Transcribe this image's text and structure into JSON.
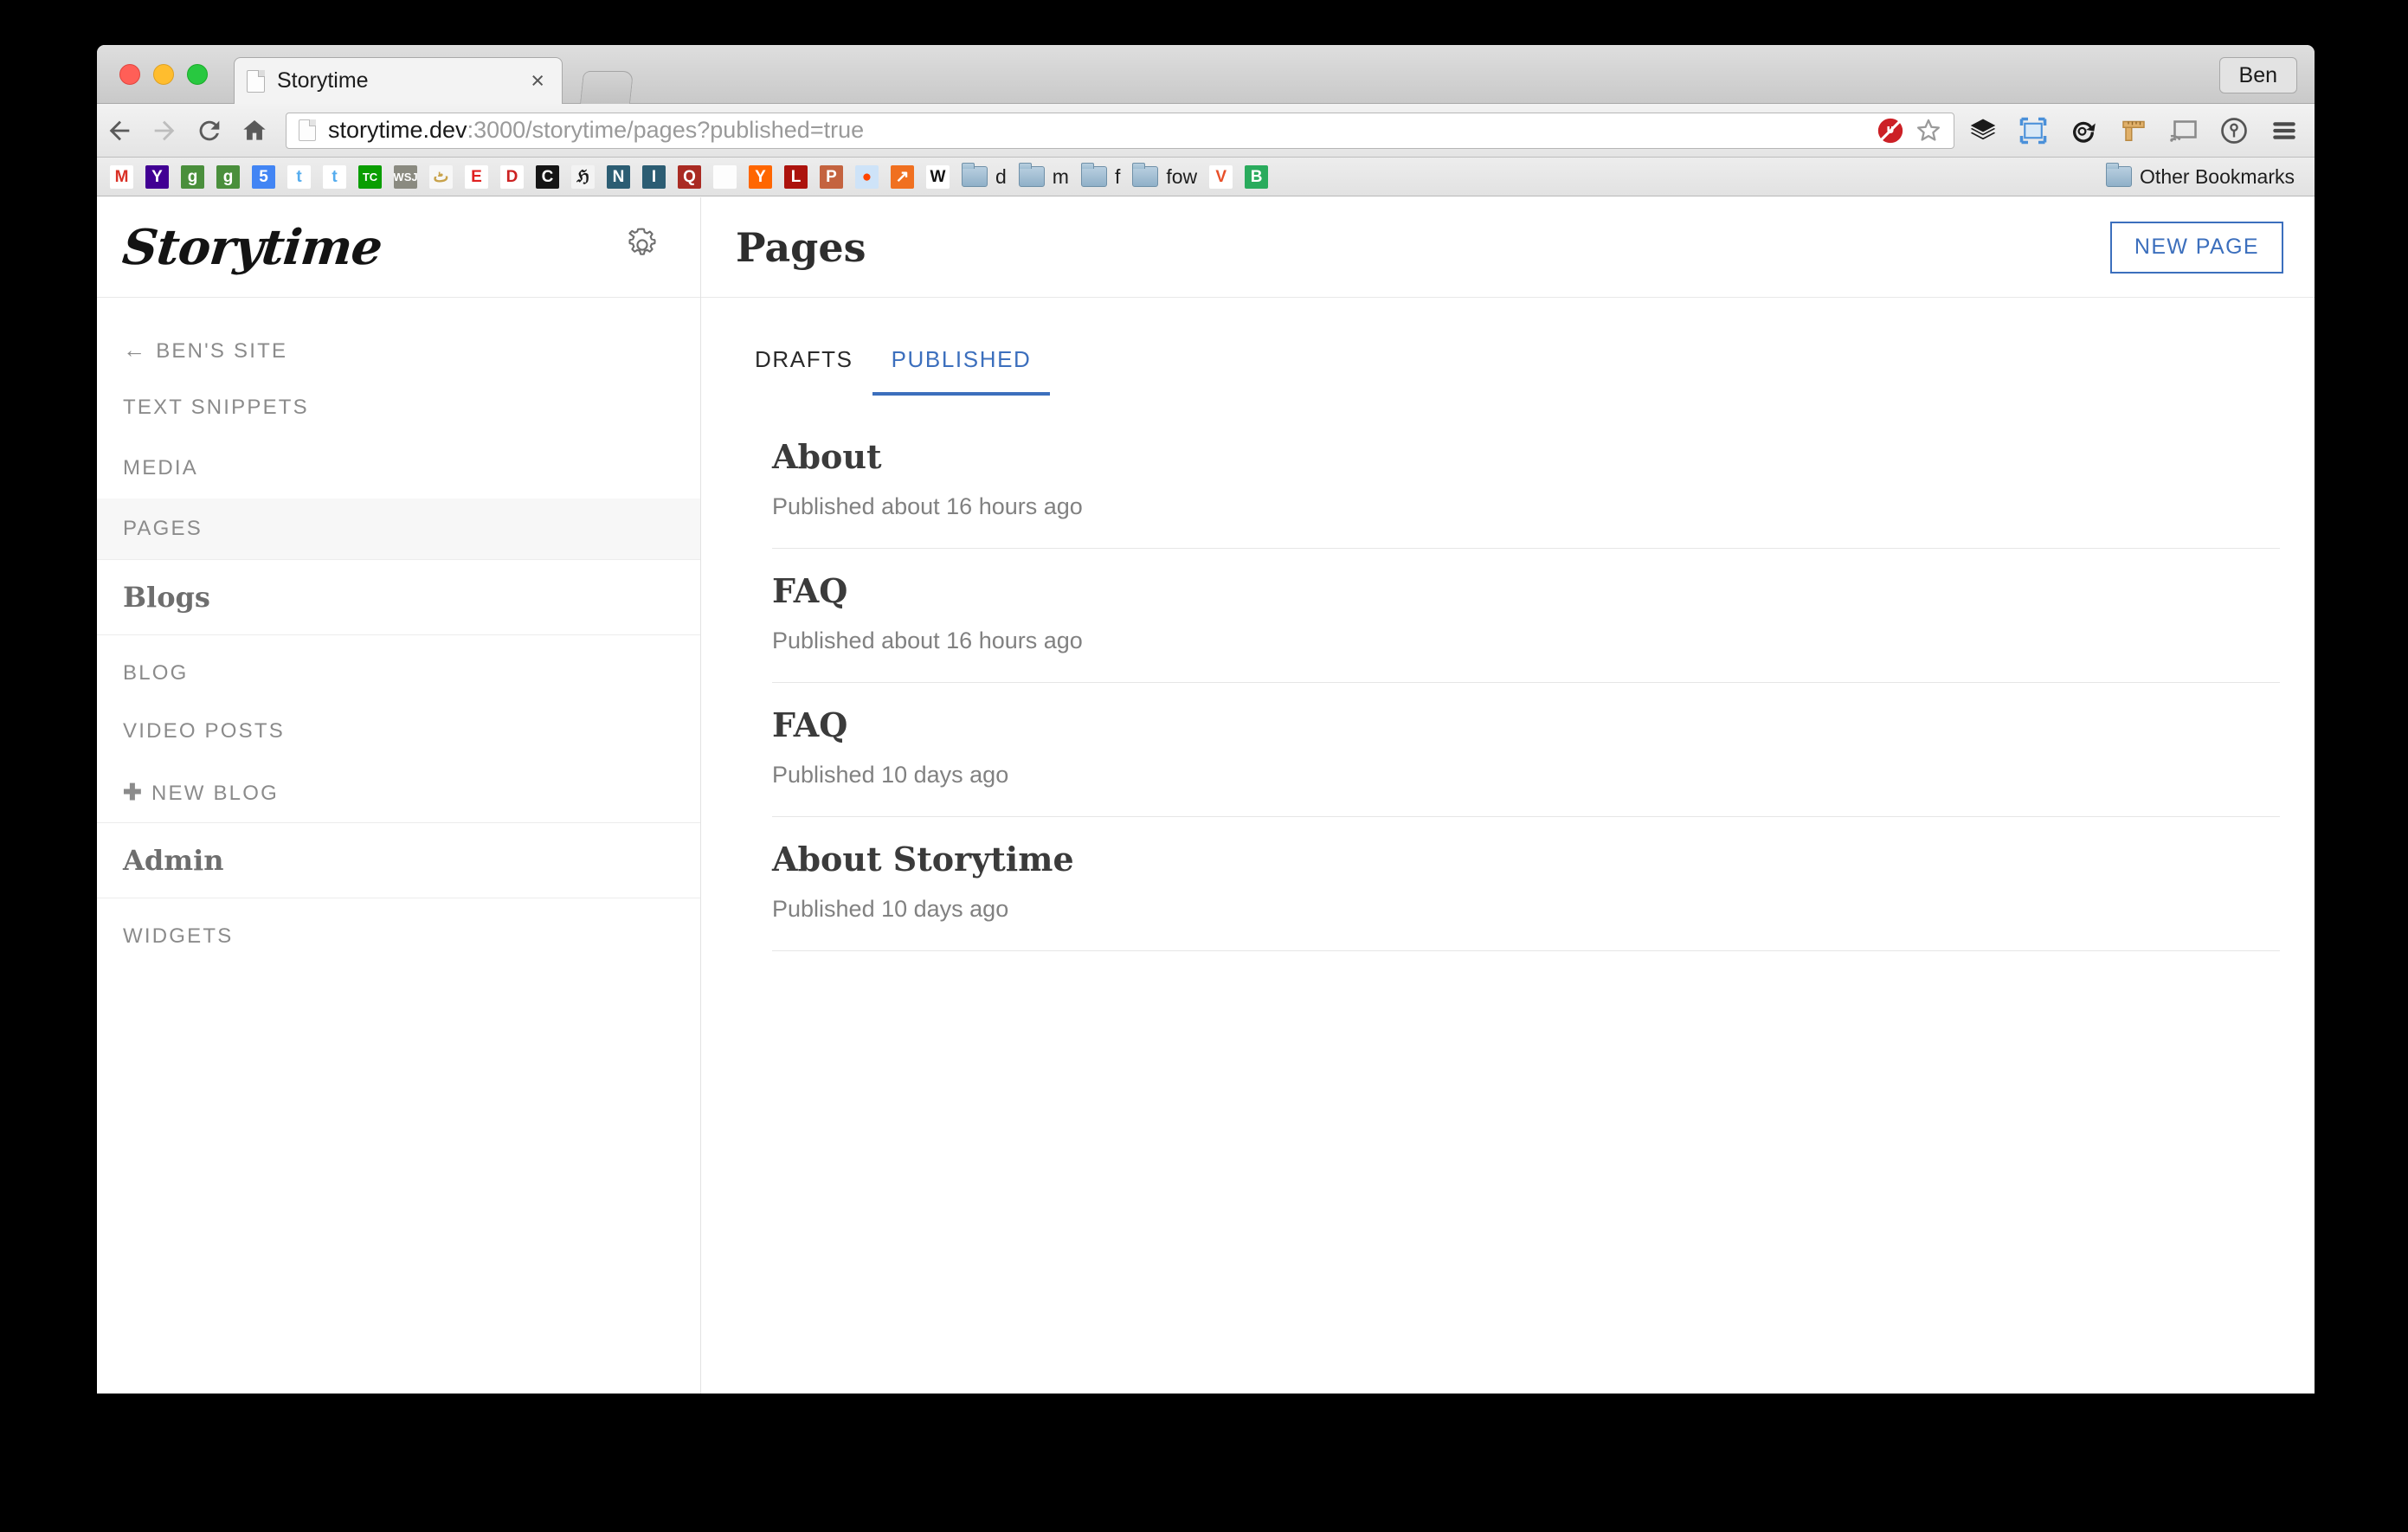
{
  "browser": {
    "tab": {
      "title": "Storytime",
      "close_label": "×"
    },
    "profile": {
      "name": "Ben"
    },
    "toolbar": {
      "back_icon": "back-arrow-icon",
      "forward_icon": "forward-arrow-icon",
      "reload_icon": "reload-icon",
      "home_icon": "home-icon",
      "url_host": "storytime.dev",
      "url_rest": ":3000/storytime/pages?published=true",
      "url_full": "storytime.dev:3000/storytime/pages?published=true",
      "blocked_icon": "blocked-plugin-icon",
      "bookmark_star_icon": "star-icon",
      "extensions": [
        "layers-icon",
        "screenshot-frame-icon",
        "refresh-clock-icon",
        "ruler-icon",
        "cast-icon",
        "onepassword-icon",
        "chrome-menu-icon"
      ]
    },
    "bookmarks": {
      "items": [
        {
          "name": "gmail",
          "glyph": "M",
          "bg": "#ffffff",
          "fg": "#d93025"
        },
        {
          "name": "yahoo",
          "glyph": "Y",
          "bg": "#410093",
          "fg": "#ffffff"
        },
        {
          "name": "google-maps-1",
          "glyph": "g",
          "bg": "#4a8f3c",
          "fg": "#ffffff"
        },
        {
          "name": "google-maps-2",
          "glyph": "g",
          "bg": "#4a8f3c",
          "fg": "#ffffff"
        },
        {
          "name": "google-calendar",
          "glyph": "5",
          "bg": "#4285f4",
          "fg": "#ffffff"
        },
        {
          "name": "twitter-1",
          "glyph": "t",
          "bg": "#ffffff",
          "fg": "#55acee"
        },
        {
          "name": "twitter-2",
          "glyph": "t",
          "bg": "#ffffff",
          "fg": "#55acee"
        },
        {
          "name": "techcrunch",
          "glyph": "TC",
          "bg": "#0a9e01",
          "fg": "#ffffff"
        },
        {
          "name": "wall-street-journal",
          "glyph": "WSJ",
          "bg": "#8a8a80",
          "fg": "#ffffff"
        },
        {
          "name": "al-jazeera",
          "glyph": "ٹ",
          "bg": "#f7f7f7",
          "fg": "#c8a24a"
        },
        {
          "name": "espn",
          "glyph": "E",
          "bg": "#ffffff",
          "fg": "#e02020"
        },
        {
          "name": "drudge",
          "glyph": "D",
          "bg": "#ffffff",
          "fg": "#cc2222"
        },
        {
          "name": "c-dark",
          "glyph": "C",
          "bg": "#151515",
          "fg": "#ffffff"
        },
        {
          "name": "chronicle",
          "glyph": "ℌ",
          "bg": "#f3f3f3",
          "fg": "#1a1a1a"
        },
        {
          "name": "nv-blue",
          "glyph": "N",
          "bg": "#2c5d73",
          "fg": "#ffffff"
        },
        {
          "name": "instapaper",
          "glyph": "I",
          "bg": "#2c5d73",
          "fg": "#ffffff"
        },
        {
          "name": "quora",
          "glyph": "Q",
          "bg": "#aa2b23",
          "fg": "#ffffff"
        },
        {
          "name": "blank-page",
          "glyph": "",
          "bg": "#fdfdfd",
          "fg": "#999999"
        },
        {
          "name": "hacker-news",
          "glyph": "Y",
          "bg": "#ff6600",
          "fg": "#ffffff"
        },
        {
          "name": "lobsters",
          "glyph": "L",
          "bg": "#ac130d",
          "fg": "#ffffff"
        },
        {
          "name": "product-hunt",
          "glyph": "P",
          "bg": "#c4633f",
          "fg": "#ffffff"
        },
        {
          "name": "reddit",
          "glyph": "●",
          "bg": "#cee3f8",
          "fg": "#ff4500"
        },
        {
          "name": "stocks",
          "glyph": "↗",
          "bg": "#f07020",
          "fg": "#ffffff"
        },
        {
          "name": "w-logo",
          "glyph": "W",
          "bg": "#ffffff",
          "fg": "#111111"
        }
      ],
      "folders": [
        {
          "name": "folder-d",
          "label": "d"
        },
        {
          "name": "folder-m",
          "label": "m"
        },
        {
          "name": "folder-f",
          "label": "f"
        },
        {
          "name": "folder-fow",
          "label": "fow"
        }
      ],
      "trailing": [
        {
          "name": "vimeo-v",
          "glyph": "V",
          "bg": "#ffffff",
          "fg": "#e8502a"
        },
        {
          "name": "b-green",
          "glyph": "B",
          "bg": "#2aab5d",
          "fg": "#ffffff"
        }
      ],
      "other_bookmarks_label": "Other Bookmarks"
    }
  },
  "app": {
    "brand": "Storytime",
    "settings_icon": "gear-icon",
    "sidebar": {
      "items": [
        {
          "label": "Ben's Site",
          "icon": "left-arrow-icon",
          "active": false
        },
        {
          "label": "Text Snippets",
          "icon": "",
          "active": false
        },
        {
          "label": "Media",
          "icon": "",
          "active": false
        },
        {
          "label": "Pages",
          "icon": "",
          "active": true
        }
      ],
      "blogs_group": "Blogs",
      "blogs_items": [
        {
          "label": "Blog",
          "icon": ""
        },
        {
          "label": "Video Posts",
          "icon": ""
        },
        {
          "label": "New Blog",
          "icon": "plus-icon"
        }
      ],
      "admin_group": "Admin",
      "admin_items": [
        {
          "label": "Widgets",
          "icon": ""
        }
      ]
    },
    "header": {
      "title": "Pages",
      "new_page_label": "NEW PAGE"
    },
    "tabs": [
      {
        "label": "DRAFTS",
        "active": false
      },
      {
        "label": "PUBLISHED",
        "active": true
      }
    ],
    "pages": [
      {
        "title": "About",
        "meta": "Published about 16 hours ago"
      },
      {
        "title": "FAQ",
        "meta": "Published about 16 hours ago"
      },
      {
        "title": "FAQ",
        "meta": "Published 10 days ago"
      },
      {
        "title": "About Storytime",
        "meta": "Published 10 days ago"
      }
    ],
    "colors": {
      "accent": "#3c6fbd",
      "muted": "#8b8b8b",
      "heading": "#3b3b3b"
    }
  }
}
